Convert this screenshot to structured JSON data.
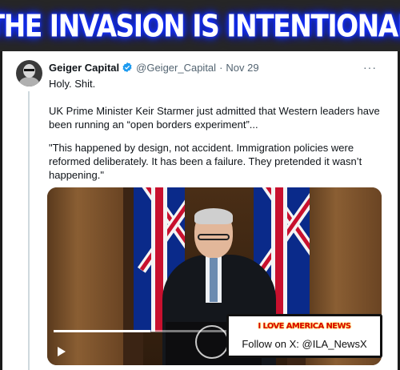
{
  "banner": {
    "headline": "THE INVASION IS INTENTIONAL"
  },
  "tweet": {
    "author_name": "Geiger Capital",
    "verified": true,
    "handle": "@Geiger_Capital",
    "separator": "·",
    "date": "Nov 29",
    "more_label": "···",
    "line1": "Holy. Shit.",
    "line2": "UK Prime Minister Keir Starmer just admitted that Western leaders have been running an “open borders experiment”...",
    "line3": "\"This happened by design, not accident. Immigration policies were reformed deliberately. It has been a failure. They pretended it wasn’t happening.\""
  },
  "video": {
    "progress": 0.3
  },
  "watermark": {
    "brand": "I LOVE AMERICA NEWS",
    "follow": "Follow on X: @ILA_NewsX"
  },
  "colors": {
    "verified_badge": "#1d9bf0",
    "banner_glow": "#1530ff",
    "watermark_brand": "#d80000"
  }
}
